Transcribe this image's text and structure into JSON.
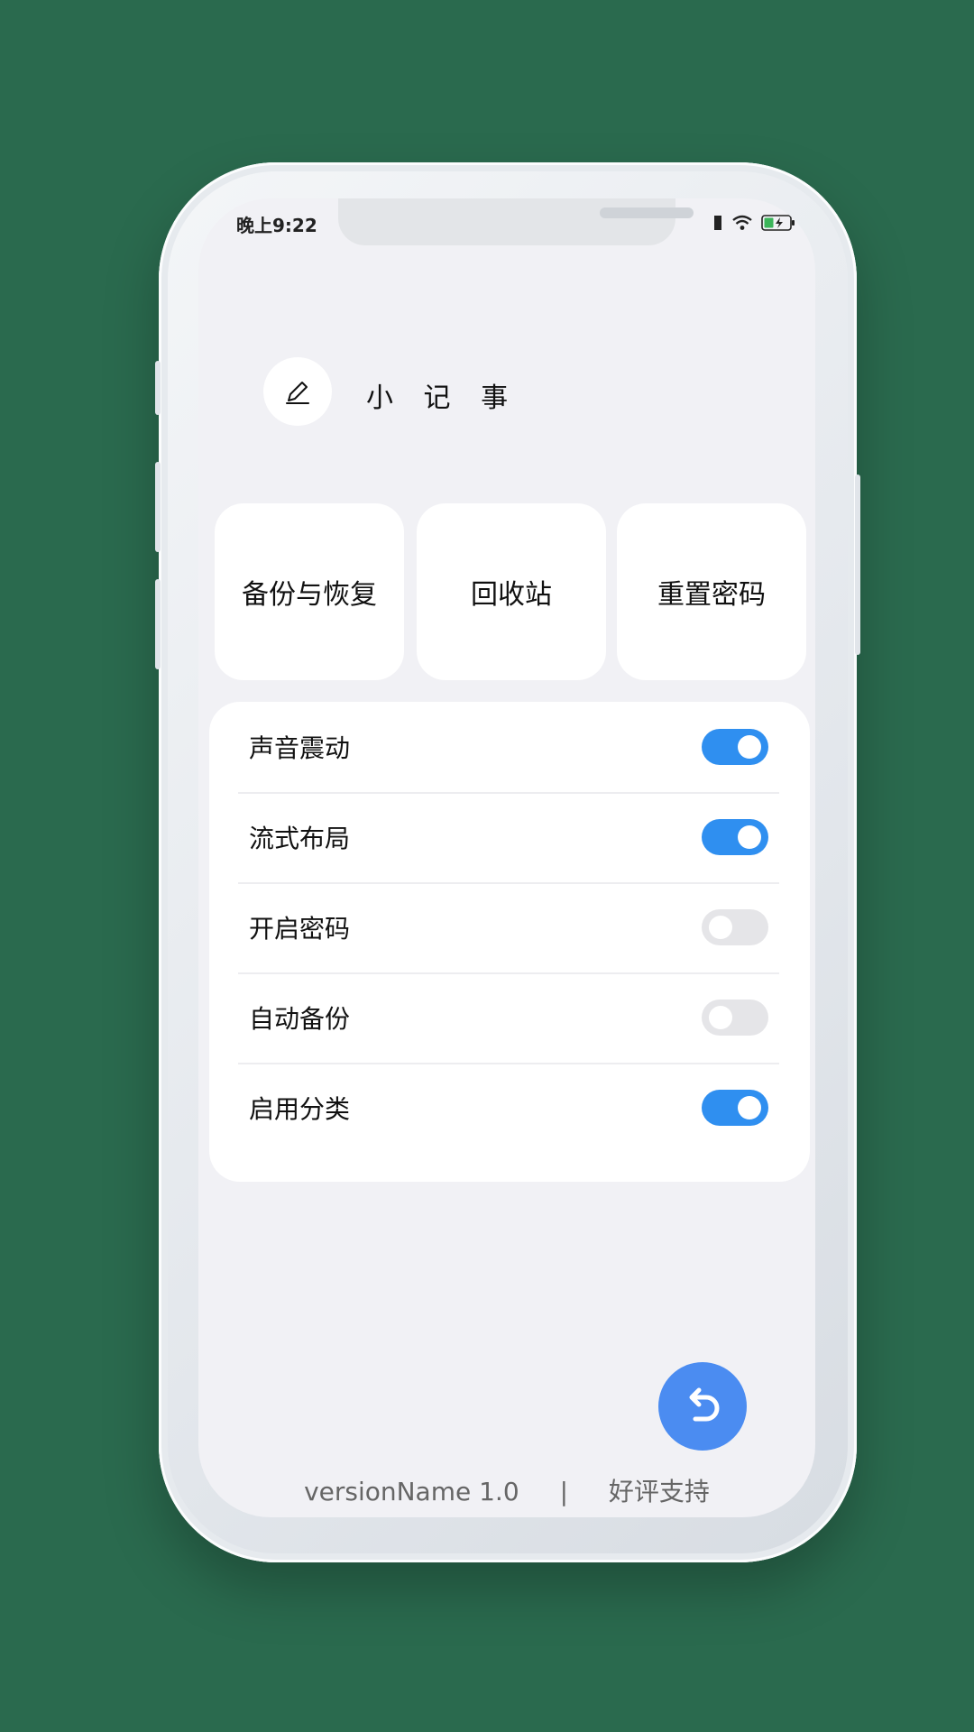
{
  "status_bar": {
    "time": "晚上9:22"
  },
  "app": {
    "title": "小 记 事"
  },
  "tiles": [
    {
      "label": "备份与恢复"
    },
    {
      "label": "回收站"
    },
    {
      "label": "重置密码"
    }
  ],
  "settings": [
    {
      "label": "声音震动",
      "enabled": true
    },
    {
      "label": "流式布局",
      "enabled": true
    },
    {
      "label": "开启密码",
      "enabled": false
    },
    {
      "label": "自动备份",
      "enabled": false
    },
    {
      "label": "启用分类",
      "enabled": true
    }
  ],
  "footer": {
    "version": "versionName 1.0",
    "separator": "|",
    "rate_link": "好评支持"
  },
  "colors": {
    "background": "#2a6a4e",
    "accent": "#2f8ff0",
    "fab": "#4b8cf1",
    "screen": "#f1f1f5"
  },
  "icons": {
    "logo": "pencil-icon",
    "fab": "undo-icon"
  }
}
